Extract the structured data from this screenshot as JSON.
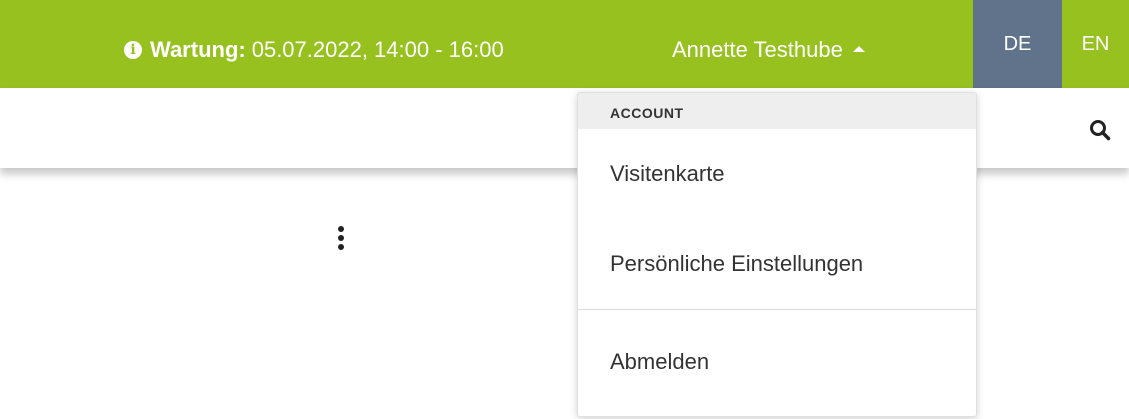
{
  "topbar": {
    "background_color": "#96c11f",
    "maintenance": {
      "icon": "info-icon",
      "label": "Wartung:",
      "text": "05.07.2022, 14:00 - 16:00"
    },
    "user": {
      "name": "Annette Testhube",
      "icon": "caret-up-icon"
    },
    "languages": [
      {
        "label": "DE",
        "active": true,
        "color": "#60738a"
      },
      {
        "label": "EN",
        "active": false
      }
    ]
  },
  "subbar": {
    "search_icon": "search-icon",
    "more_icon": "kebab-icon"
  },
  "dropdown": {
    "header": "ACCOUNT",
    "items": [
      {
        "label": "Visitenkarte"
      },
      {
        "label": "Persönliche Einstellungen"
      },
      {
        "label": "Abmelden"
      }
    ]
  }
}
